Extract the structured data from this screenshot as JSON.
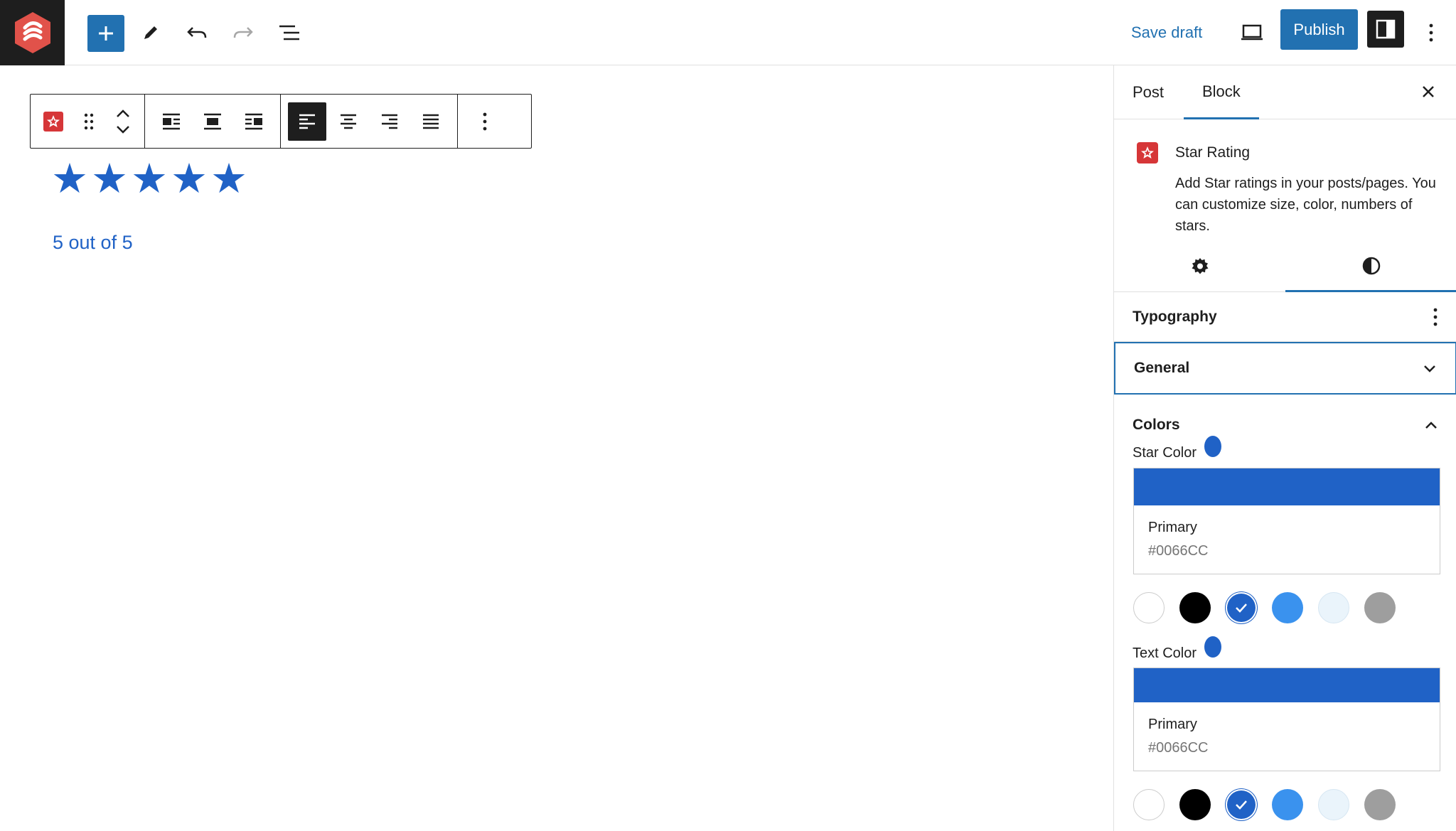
{
  "toolbar": {
    "save_draft_label": "Save draft",
    "publish_label": "Publish"
  },
  "block": {
    "stars": [
      "★",
      "★",
      "★",
      "★",
      "★"
    ],
    "rating_text": "5 out of 5"
  },
  "sidebar": {
    "tabs": [
      {
        "label": "Post"
      },
      {
        "label": "Block"
      }
    ],
    "block_card": {
      "title": "Star Rating",
      "description": "Add Star ratings in your posts/pages. You can customize size, color, numbers of stars."
    },
    "panels": {
      "typography": "Typography",
      "general": "General",
      "colors": "Colors"
    },
    "star_color": {
      "label": "Star Color",
      "selected_name": "Primary",
      "selected_hex": "#0066CC"
    },
    "text_color": {
      "label": "Text Color",
      "selected_name": "Primary",
      "selected_hex": "#0066CC"
    },
    "palette": [
      "#ffffff",
      "#000000",
      "#2062c6",
      "#3a92ee",
      "#eaf4fb",
      "#9e9e9e"
    ]
  },
  "colors": {
    "accent": "#2271b1",
    "star": "#2062c6",
    "logo_bg": "#1e1e1e",
    "logo_mark": "#e1524a"
  }
}
